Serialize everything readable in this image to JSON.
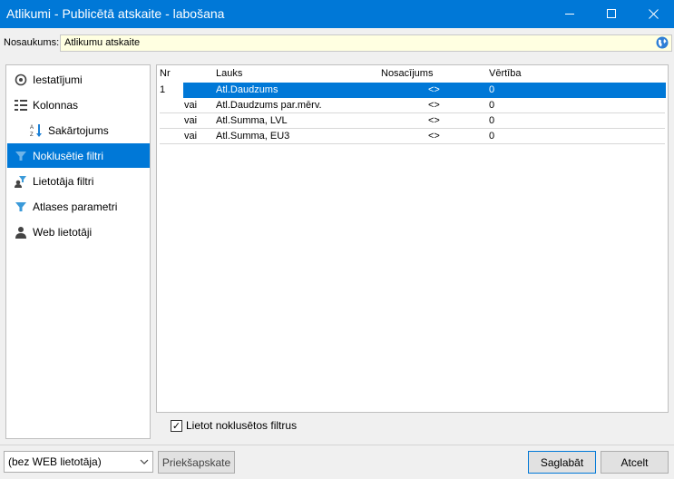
{
  "window": {
    "title": "Atlikumi - Publicētā atskaite - labošana",
    "minimize": "—",
    "maximize": "☐",
    "close": "✕"
  },
  "name_field": {
    "label": "Nosaukums:",
    "value": "Atlikumu atskaite"
  },
  "sidebar": {
    "items": [
      {
        "label": "Iestatījumi",
        "icon": "gear-icon"
      },
      {
        "label": "Kolonnas",
        "icon": "columns-icon"
      },
      {
        "label": "Sakārtojums",
        "icon": "sort-az-icon"
      },
      {
        "label": "Noklusētie filtri",
        "icon": "funnel-icon"
      },
      {
        "label": "Lietotāja filtri",
        "icon": "user-filter-icon"
      },
      {
        "label": "Atlases parametri",
        "icon": "funnel-icon"
      },
      {
        "label": "Web lietotāji",
        "icon": "user-icon"
      }
    ]
  },
  "grid": {
    "columns": [
      "Nr",
      "Lauks",
      "Nosacījums",
      "Vērtība"
    ],
    "rows": [
      {
        "nr": "1",
        "conj": "",
        "field": "Atl.Daudzums",
        "cond": "<>",
        "value": "0"
      },
      {
        "nr": "",
        "conj": "vai",
        "field": "Atl.Daudzums par.mērv.",
        "cond": "<>",
        "value": "0"
      },
      {
        "nr": "",
        "conj": "vai",
        "field": "Atl.Summa, LVL",
        "cond": "<>",
        "value": "0"
      },
      {
        "nr": "",
        "conj": "vai",
        "field": "Atl.Summa, EU3",
        "cond": "<>",
        "value": "0"
      }
    ]
  },
  "checkbox": {
    "label": "Lietot noklusētos filtrus",
    "checked": "✓"
  },
  "footer": {
    "user_select": "(bez WEB lietotāja)",
    "preview": "Priekšapskate",
    "save": "Saglabāt",
    "cancel": "Atcelt"
  },
  "colors": {
    "accent": "#0078d7",
    "input_bg": "#ffffe1"
  }
}
